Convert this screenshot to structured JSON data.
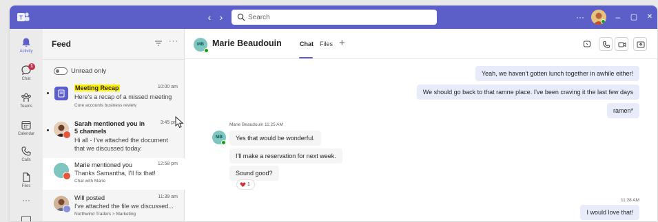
{
  "titlebar": {
    "back_glyph": "‹",
    "forward_glyph": "›",
    "search_placeholder": "Search",
    "more_glyph": "···",
    "minimize_glyph": "–",
    "maximize_glyph": "▢",
    "close_glyph": "✕",
    "accent_color": "#5b5fc7"
  },
  "rail": {
    "items": [
      {
        "label": "Activity",
        "icon": "bell-icon"
      },
      {
        "label": "Chat",
        "icon": "chat-icon",
        "badge": "1"
      },
      {
        "label": "Teams",
        "icon": "teams-icon"
      },
      {
        "label": "Calendar",
        "icon": "calendar-icon"
      },
      {
        "label": "Calls",
        "icon": "phone-icon"
      },
      {
        "label": "Files",
        "icon": "file-icon"
      }
    ],
    "more_glyph": "···"
  },
  "feed": {
    "title": "Feed",
    "more_glyph": "···",
    "toggle_label": "Unread only",
    "items": [
      {
        "title": "Meeting Recap",
        "time": "10:00 am",
        "body": "Here's a recap of a missed meeting",
        "sub": "Core accounts business review"
      },
      {
        "title": "Sarah mentioned you in",
        "title2": "5 channels",
        "time": "3:45 pm",
        "body": "Hi all - I've attached the document",
        "body2": "that we discussed today."
      },
      {
        "title": "Marie mentioned you",
        "time": "12:58 pm",
        "body": "Thanks Samantha, I'll fix that!",
        "sub": "Chat with Marie"
      },
      {
        "title": "Will posted",
        "time": "11:39 am",
        "body": "I've attached the file we discussed...",
        "sub": "Northwind Traders > Marketing"
      }
    ]
  },
  "chat": {
    "initials": "MB",
    "name": "Marie Beaudouin",
    "tabs": [
      {
        "label": "Chat"
      },
      {
        "label": "Files"
      }
    ],
    "add_glyph": "+",
    "messages_out_top": [
      "Yeah, we haven't gotten lunch together in awhile either!",
      "We should go back to that ramne place. I've been craving it the last few days",
      "ramen*"
    ],
    "incoming_meta": "Marie Beaudouin   11:25 AM",
    "messages_in": [
      "Yes that would be wonderful.",
      "I'll make a reservation for next week.",
      "Sound good?"
    ],
    "reaction_count": "1",
    "outgoing_time": "11:28 AM",
    "message_out_bottom": "I would love that!"
  }
}
